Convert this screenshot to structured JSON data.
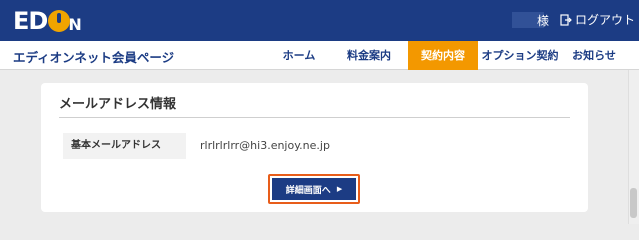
{
  "header": {
    "logo_left": "ED",
    "logo_right": "N",
    "user_suffix": "様",
    "logout_label": "ログアウト"
  },
  "nav": {
    "site_title": "エディオンネット会員ページ",
    "items": [
      {
        "label": "ホーム",
        "active": false
      },
      {
        "label": "料金案内",
        "active": false
      },
      {
        "label": "契約内容",
        "active": true
      },
      {
        "label": "オプション契約",
        "active": false
      },
      {
        "label": "お知らせ",
        "active": false
      }
    ]
  },
  "card": {
    "title": "メールアドレス情報",
    "row_label": "基本メールアドレス",
    "row_value": "rlrlrlrlrr@hi3.enjoy.ne.jp",
    "detail_button_label": "詳細画面へ",
    "detail_button_arrow": "▶"
  },
  "colors": {
    "brand_navy": "#1c3c84",
    "accent_orange": "#f39800",
    "highlight_border": "#e85d1a"
  }
}
